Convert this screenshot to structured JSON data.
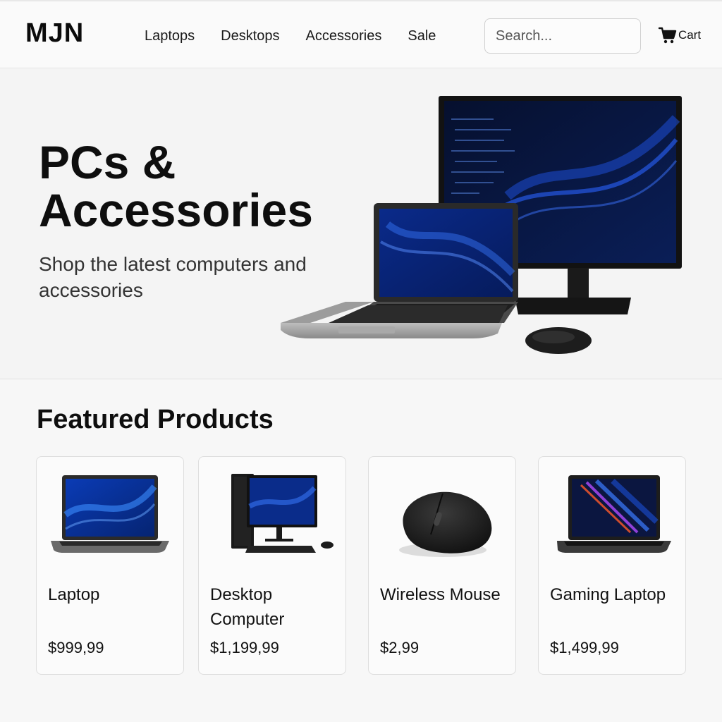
{
  "header": {
    "logo": "MJN",
    "nav": [
      "Laptops",
      "Desktops",
      "Accessories",
      "Sale"
    ],
    "search_placeholder": "Search...",
    "cart_label": "Cart",
    "icons": {
      "cart": "shopping-cart-icon"
    }
  },
  "hero": {
    "title": "PCs & Accessories",
    "subtitle": "Shop the latest computers and accessories"
  },
  "featured": {
    "title": "Featured Products",
    "products": [
      {
        "name": "Laptop",
        "price": "$999,99"
      },
      {
        "name": "Desktop Computer",
        "price": "$1,199,99"
      },
      {
        "name": "Wireless Mouse",
        "price": "$2,99"
      },
      {
        "name": "Gaming Laptop",
        "price": "$1,499,99"
      }
    ]
  },
  "colors": {
    "accent": "#0b3a8f",
    "text": "#111111",
    "background": "#f7f7f7"
  }
}
